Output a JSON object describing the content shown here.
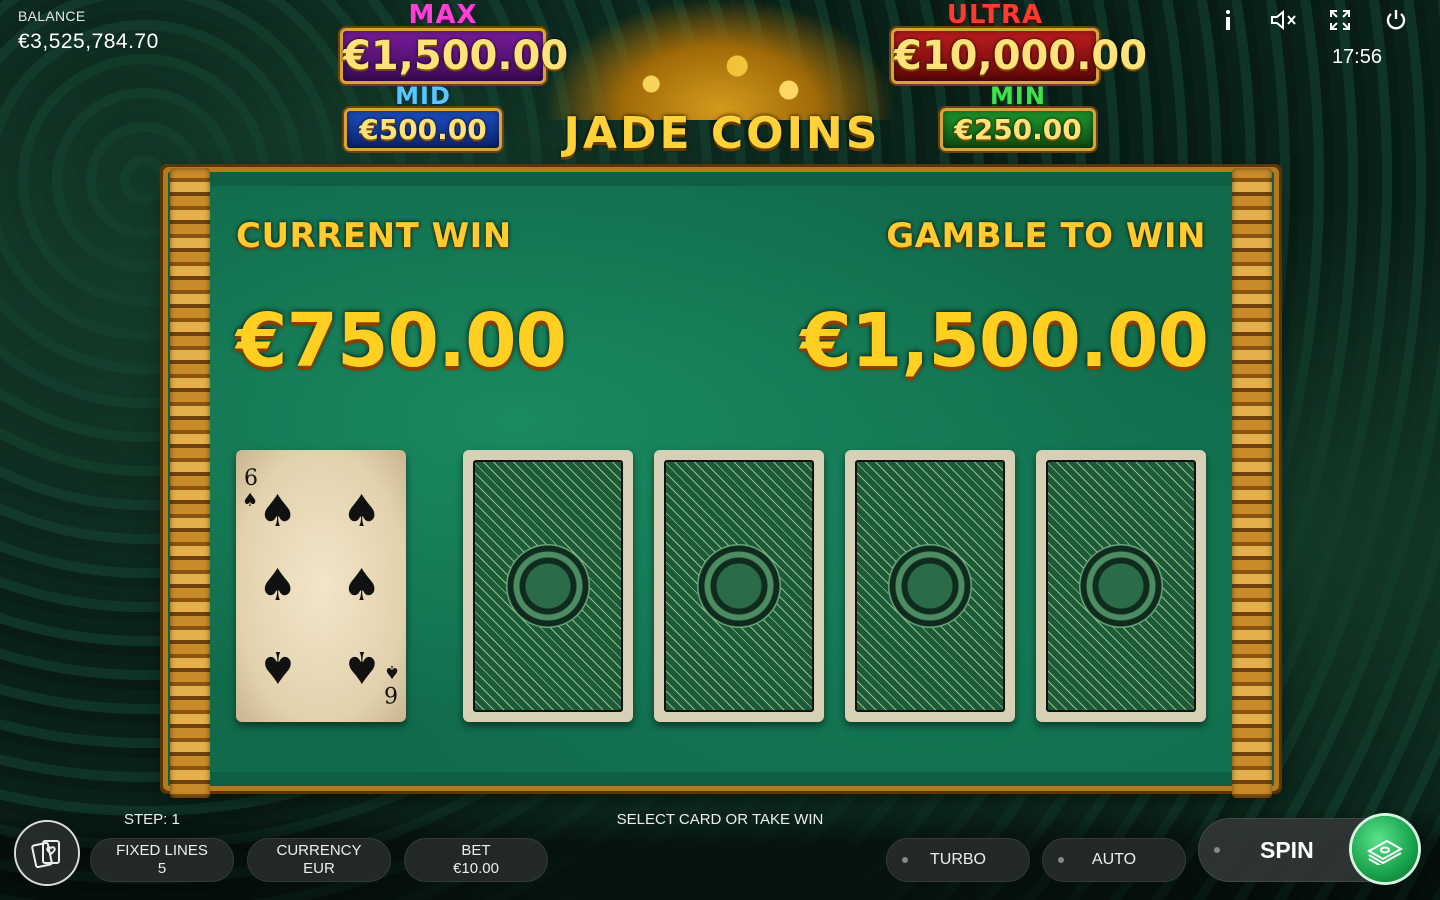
{
  "balance": {
    "label": "BALANCE",
    "value": "€3,525,784.70"
  },
  "clock": "17:56",
  "jackpots": {
    "max": {
      "name": "MAX",
      "value": "€1,500.00"
    },
    "mid": {
      "name": "MID",
      "value": "€500.00"
    },
    "ultra": {
      "name": "ULTRA",
      "value": "€10,000.00"
    },
    "min": {
      "name": "MIN",
      "value": "€250.00"
    }
  },
  "logo": "JADE COINS",
  "gamble": {
    "current_win_label": "CURRENT WIN",
    "current_win_value": "€750.00",
    "gamble_to_win_label": "GAMBLE TO WIN",
    "gamble_to_win_value": "€1,500.00",
    "dealer_card": {
      "rank": "6",
      "suit": "♠"
    },
    "face_down_cards": 4
  },
  "bottom": {
    "step": "STEP: 1",
    "message": "SELECT CARD OR TAKE WIN",
    "fixed_lines": {
      "label": "FIXED LINES",
      "value": "5"
    },
    "currency": {
      "label": "CURRENCY",
      "value": "EUR"
    },
    "bet": {
      "label": "BET",
      "value": "€10.00"
    },
    "turbo": "TURBO",
    "auto": "AUTO",
    "spin": "SPIN"
  },
  "icons": [
    "info-icon",
    "mute-icon",
    "fullscreen-icon",
    "power-icon",
    "cards-icon",
    "cash-icon"
  ]
}
